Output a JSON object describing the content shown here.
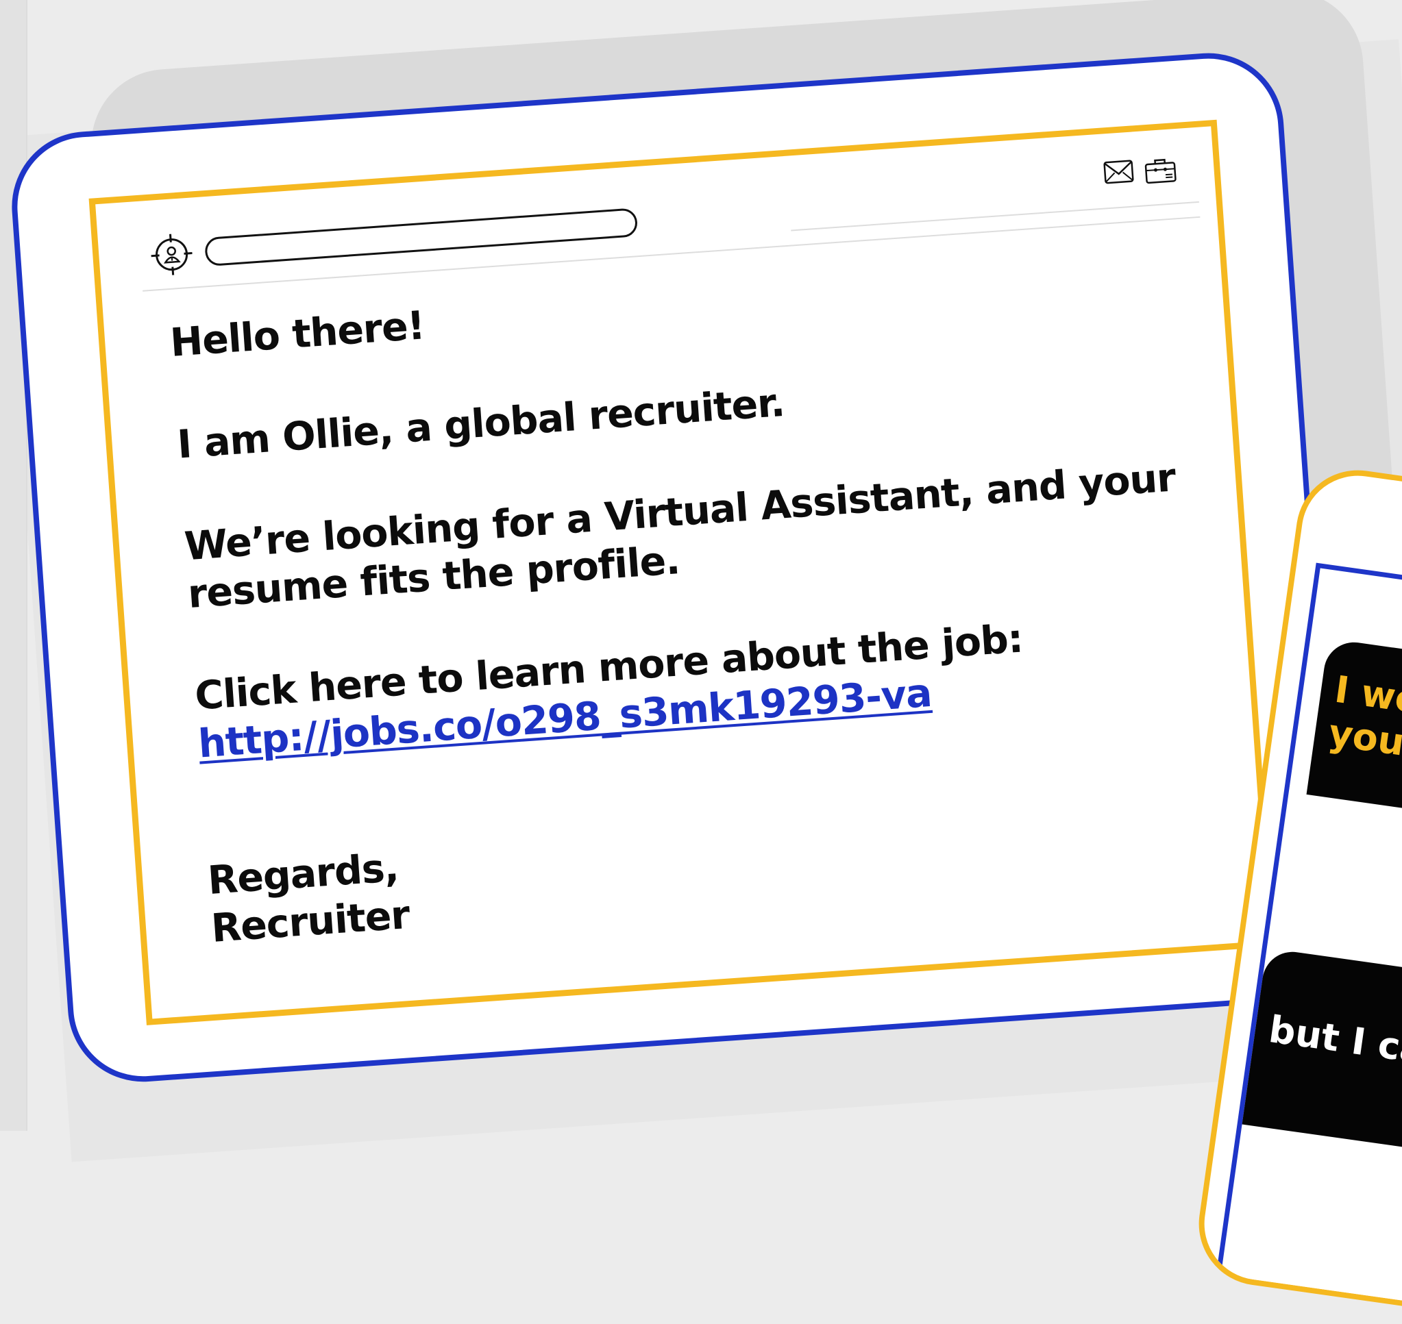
{
  "colors": {
    "tablet_frame": "#1e35c8",
    "screen_frame": "#f5b820",
    "link": "#1d33c4",
    "background": "#ececec"
  },
  "toolbar": {
    "left_icon": "recruiter-target-icon",
    "right_icons": [
      "envelope-icon",
      "briefcase-icon"
    ]
  },
  "email": {
    "greeting": "Hello there!",
    "intro": "I am Ollie, a global recruiter.",
    "pitch_line1": "We’re looking for a Virtual Assistant, and your",
    "pitch_line2": "resume fits the profile.",
    "cta": "Click here to learn more about the job:",
    "link": "http://jobs.co/o298_s3mk19293-va",
    "signoff": "Regards,",
    "signature": "Recruiter"
  },
  "phone": {
    "bubble_1_line1": "I wo",
    "bubble_1_line2": "you",
    "bubble_2": "but I ca"
  }
}
